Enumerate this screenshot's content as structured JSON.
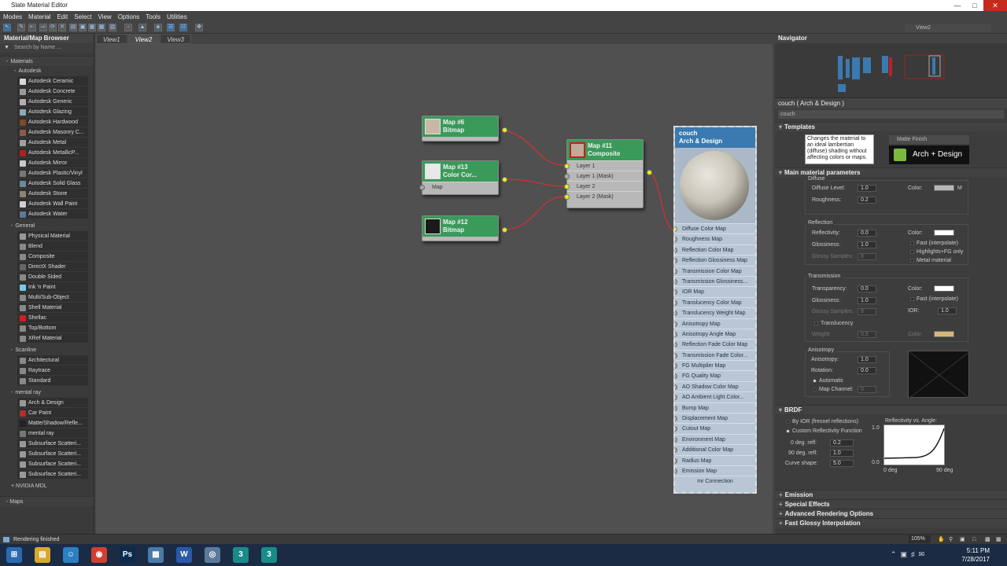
{
  "window": {
    "title": "Slate Material Editor"
  },
  "menu": [
    "Modes",
    "Material",
    "Edit",
    "Select",
    "View",
    "Options",
    "Tools",
    "Utilities"
  ],
  "toolbar": {
    "view_dropdown": "View2"
  },
  "browser": {
    "title": "Material/Map Browser",
    "search_placeholder": "Search by Name ...",
    "materials_label": "Materials",
    "autodesk_label": "Autodesk",
    "autodesk_items": [
      {
        "label": "Autodesk Ceramic",
        "color": "#d8d8d8"
      },
      {
        "label": "Autodesk Concrete",
        "color": "#9a9a9a"
      },
      {
        "label": "Autodesk Generic",
        "color": "#b0b0b0"
      },
      {
        "label": "Autodesk Glazing",
        "color": "#8fa8b8"
      },
      {
        "label": "Autodesk Hardwood",
        "color": "#7a4a2a"
      },
      {
        "label": "Autodesk Masonry C...",
        "color": "#8a5a4a"
      },
      {
        "label": "Autodesk Metal",
        "color": "#a0a0a0"
      },
      {
        "label": "Autodesk MetallicP...",
        "color": "#b02020"
      },
      {
        "label": "Autodesk Mirror",
        "color": "#c8c8c8"
      },
      {
        "label": "Autodesk Plastic/Vinyl",
        "color": "#777777"
      },
      {
        "label": "Autodesk Solid Glass",
        "color": "#6a8a9a"
      },
      {
        "label": "Autodesk Stone",
        "color": "#8a8478"
      },
      {
        "label": "Autodesk Wall Paint",
        "color": "#d0d0d0"
      },
      {
        "label": "Autodesk Water",
        "color": "#5a7a9a"
      }
    ],
    "general_label": "General",
    "general_items": [
      {
        "label": "Physical Material",
        "color": "#999999"
      },
      {
        "label": "Blend",
        "color": "#888888"
      },
      {
        "label": "Composite",
        "color": "#888888"
      },
      {
        "label": "DirectX Shader",
        "color": "#666666"
      },
      {
        "label": "Double Sided",
        "color": "#888888"
      },
      {
        "label": "Ink 'n Paint",
        "color": "#7ac8e8"
      },
      {
        "label": "Multi/Sub-Object",
        "color": "#888888"
      },
      {
        "label": "Shell Material",
        "color": "#888888"
      },
      {
        "label": "Shellac",
        "color": "#cc2020"
      },
      {
        "label": "Top/Bottom",
        "color": "#888888"
      },
      {
        "label": "XRef Material",
        "color": "#888888"
      }
    ],
    "scanline_label": "Scanline",
    "scanline_items": [
      {
        "label": "Architectural",
        "color": "#888888"
      },
      {
        "label": "Raytrace",
        "color": "#888888"
      },
      {
        "label": "Standard",
        "color": "#888888"
      }
    ],
    "mentalray_label": "mental ray",
    "mentalray_items": [
      {
        "label": "Arch & Design",
        "color": "#999999"
      },
      {
        "label": "Car Paint",
        "color": "#b03030"
      },
      {
        "label": "Matte/Shadow/Refle...",
        "color": "#222222"
      },
      {
        "label": "mental ray",
        "color": "#777777"
      },
      {
        "label": "Subsurface Scatteri...",
        "color": "#999999"
      },
      {
        "label": "Subsurface Scatteri...",
        "color": "#999999"
      },
      {
        "label": "Subsurface Scatteri...",
        "color": "#999999"
      },
      {
        "label": "Subsurface Scatteri...",
        "color": "#999999"
      }
    ],
    "nvidia_label": "+ NVIDIA MDL",
    "maps_label": "- Maps"
  },
  "views": [
    "View1",
    "View2",
    "View3"
  ],
  "nodes": {
    "map6": {
      "title": "Map #6",
      "type": "Bitmap"
    },
    "map13": {
      "title": "Map #13",
      "type": "Color Cor...",
      "slot": "Map"
    },
    "map12": {
      "title": "Map #12",
      "type": "Bitmap"
    },
    "map11": {
      "title": "Map #11",
      "type": "Composite",
      "slots": [
        "Layer 1",
        "Layer 1 (Mask)",
        "Layer 2",
        "Layer 2 (Mask)"
      ]
    },
    "couch": {
      "title": "couch",
      "type": "Arch & Design",
      "slots": [
        "Diffuse Color Map",
        "Roughness Map",
        "Reflection Color Map",
        "Reflection Glossiness Map",
        "Transmission Color Map",
        "Transmission Glossiness...",
        "IOR Map",
        "Translucency Color Map",
        "Translucency Weight Map",
        "Anisotropy Map",
        "Anisotropy Angle Map",
        "Reflection Fade Color Map",
        "Transmission Fade Color...",
        "FG Multiplier Map",
        "FG Quality Map",
        "AO Shadow Color Map",
        "AO Ambient Light Color...",
        "Bump Map",
        "Displacement Map",
        "Cutout Map",
        "Environment Map",
        "Additional Color Map",
        "Radius Map",
        "Emission Map",
        "mr Connection"
      ]
    }
  },
  "navigator": {
    "title": "Navigator"
  },
  "props": {
    "header": "couch  ( Arch & Design )",
    "name": "couch",
    "templates_label": "Templates",
    "template_desc": "Changes the material to an ideal lambertian (diffuse) shading without affecting colors or maps.",
    "template_dropdown": "Matte Finish",
    "arch_label": "Arch + Design",
    "main_params": "Main material parameters",
    "diffuse": {
      "group": "Diffuse",
      "level_label": "Diffuse Level:",
      "level": "1.0",
      "roughness_label": "Roughness:",
      "roughness": "0.2",
      "color_label": "Color:",
      "m": "M",
      "color": "#b8b8b8"
    },
    "reflection": {
      "group": "Reflection",
      "reflectivity_label": "Reflectivity:",
      "reflectivity": "0.0",
      "glossiness_label": "Glossiness:",
      "glossiness": "1.0",
      "samples_label": "Glossy Samples:",
      "samples": "8",
      "color_label": "Color:",
      "color": "#ffffff",
      "fast": "Fast (interpolate)",
      "highlights": "Highlights+FG only",
      "metal": "Metal material"
    },
    "transmission": {
      "group": "Transmission",
      "transparency_label": "Transparency:",
      "transparency": "0.0",
      "glossiness_label": "Glossiness:",
      "glossiness": "1.0",
      "samples_label": "Glossy Samples:",
      "samples": "8",
      "color_label": "Color:",
      "color": "#ffffff",
      "fast": "Fast (interpolate)",
      "ior_label": "IOR:",
      "ior": "1.0"
    },
    "translucency": {
      "label": "Translucency",
      "weight_label": "Weight:",
      "weight": "0.5",
      "color_label": "Color:",
      "color": "#d8b878"
    },
    "anisotropy": {
      "group": "Anisotropy",
      "aniso_label": "Anisotropy:",
      "aniso": "1.0",
      "rotation_label": "Rotation:",
      "rotation": "0.0",
      "automatic": "Automatic",
      "map_channel_label": "Map Channel:",
      "map_channel": "0"
    },
    "brdf": {
      "label": "BRDF",
      "by_ior": "By IOR (fresnel reflections)",
      "custom": "Custom Reflectivity Function",
      "deg0_label": "0 deg. refl:",
      "deg0": "0.2",
      "deg90_label": "90 deg. refl:",
      "deg90": "1.0",
      "curve_label": "Curve shape:",
      "curve": "5.0",
      "graph_title": "Reflectivity vs. Angle:",
      "y_top": "1.0",
      "y_bottom": "0.0",
      "x_left": "0 deg",
      "x_right": "90 deg"
    },
    "collapsed": [
      "Emission",
      "Special Effects",
      "Advanced Rendering Options",
      "Fast Glossy Interpolation"
    ]
  },
  "status": {
    "text": "Rendering finished",
    "zoom": "105%"
  },
  "clock": {
    "time": "5:11 PM",
    "date": "7/28/2017"
  },
  "taskbar_apps": [
    {
      "name": "start-icon",
      "glyph": "⊞",
      "color": "#2a6ab0"
    },
    {
      "name": "file-explorer-icon",
      "glyph": "▤",
      "color": "#d8a830"
    },
    {
      "name": "app-icon",
      "glyph": "☺",
      "color": "#2a80c0"
    },
    {
      "name": "chrome-icon",
      "glyph": "◉",
      "color": "#d04030"
    },
    {
      "name": "photoshop-icon",
      "glyph": "Ps",
      "color": "#0a2a50"
    },
    {
      "name": "app2-icon",
      "glyph": "▦",
      "color": "#4a7aa8"
    },
    {
      "name": "word-icon",
      "glyph": "W",
      "color": "#2a5aa8"
    },
    {
      "name": "app3-icon",
      "glyph": "◎",
      "color": "#5a7a9a"
    },
    {
      "name": "3dsmax-icon-1",
      "glyph": "3",
      "color": "#1a8a8a"
    },
    {
      "name": "3dsmax-icon-2",
      "glyph": "3",
      "color": "#1a8a8a"
    }
  ]
}
